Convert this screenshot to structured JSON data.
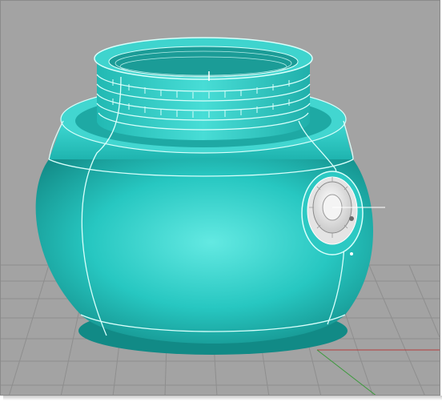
{
  "viewport": {
    "title": "",
    "display_mode": "Shaded",
    "background_color": "#a3a3a3",
    "grid_color": "#8e8e8e",
    "axis_x_color": "#b43c3c",
    "axis_y_color": "#3c9a3c"
  },
  "model": {
    "object": "jar-with-threaded-neck",
    "surface_color": "#2cc9c3",
    "isocurve_color": "#d8fffb",
    "selected_detail": "dial-badge"
  }
}
